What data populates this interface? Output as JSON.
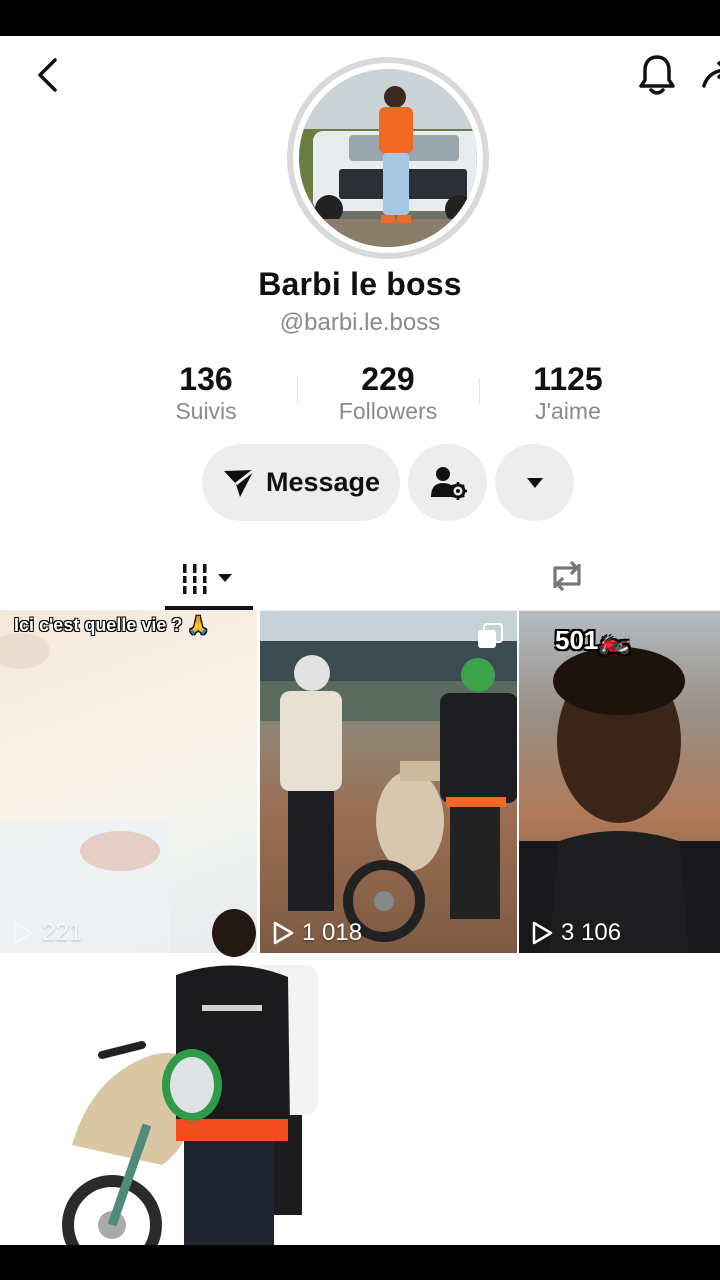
{
  "profile": {
    "display_name": "Barbi le boss",
    "username": "@barbi.le.boss"
  },
  "stats": [
    {
      "value": "136",
      "label": "Suivis"
    },
    {
      "value": "229",
      "label": "Followers"
    },
    {
      "value": "1125",
      "label": "J'aime"
    }
  ],
  "actions": {
    "message_label": "Message"
  },
  "header_icons": [
    "back-arrow-icon",
    "bell-icon",
    "share-icon"
  ],
  "tabs": [
    {
      "name": "videos",
      "icon": "grid-icon",
      "active": true
    },
    {
      "name": "reposts",
      "icon": "repost-icon",
      "active": false
    }
  ],
  "videos": [
    {
      "views": "221",
      "caption": "Ici c'est quelle vie ? 🙏"
    },
    {
      "views": "1 018",
      "multi_photo": true
    },
    {
      "views": "3 106",
      "overlay": "501🏍️"
    }
  ],
  "colors": {
    "background": "#ffffff",
    "button_bg": "#ededed",
    "text_primary": "#111111",
    "text_secondary": "#8a8a8a"
  }
}
